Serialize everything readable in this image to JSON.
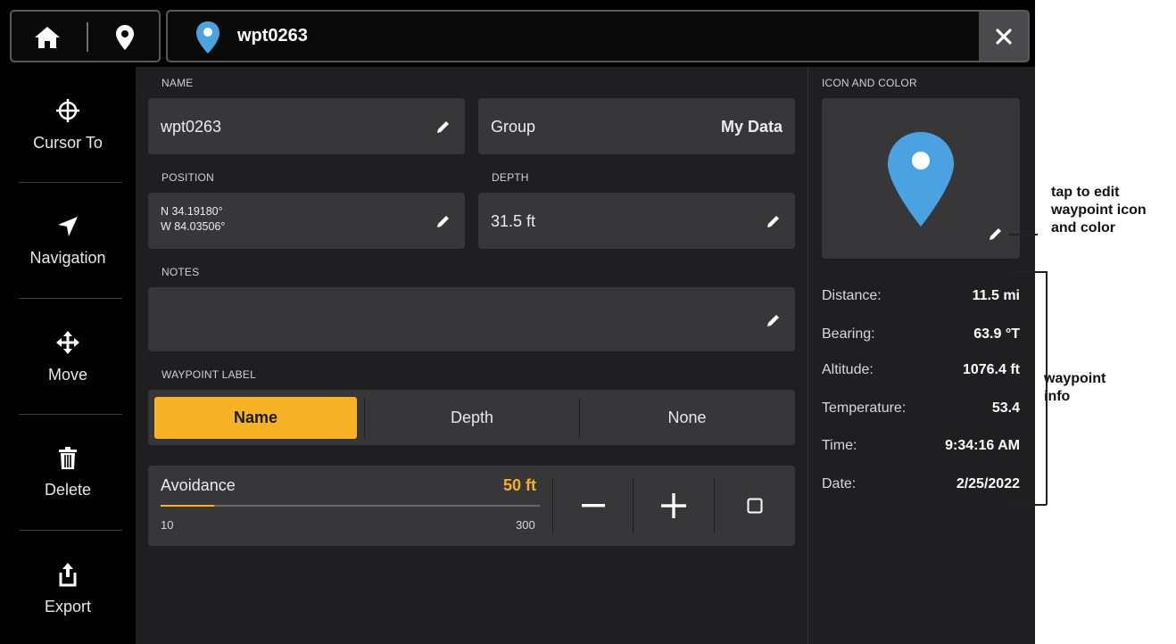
{
  "titlebar": {
    "title": "wpt0263"
  },
  "sidebar": {
    "items": [
      {
        "label": "Cursor To",
        "icon": "crosshair-icon"
      },
      {
        "label": "Navigation",
        "icon": "navigation-arrow-icon"
      },
      {
        "label": "Move",
        "icon": "move-icon"
      },
      {
        "label": "Delete",
        "icon": "trash-icon"
      },
      {
        "label": "Export",
        "icon": "export-icon"
      }
    ]
  },
  "form": {
    "name_label": "NAME",
    "name_value": "wpt0263",
    "group_label": "Group",
    "group_value": "My Data",
    "position_label": "POSITION",
    "position_lat": "N 34.19180°",
    "position_lon": "W 84.03506°",
    "depth_label": "DEPTH",
    "depth_value": "31.5 ft",
    "notes_label": "NOTES",
    "notes_value": "",
    "waypoint_label_title": "WAYPOINT LABEL",
    "label_options": [
      "Name",
      "Depth",
      "None"
    ],
    "label_selected": "Name",
    "avoidance_label": "Avoidance",
    "avoidance_value": "50 ft",
    "avoidance_min": "10",
    "avoidance_max": "300",
    "avoidance_fill": 0.14
  },
  "icon_color": {
    "label": "ICON AND COLOR",
    "pin_color": "#4aa3e0"
  },
  "info": {
    "rows": [
      {
        "k": "Distance:",
        "v": "11.5 mi"
      },
      {
        "k": "Bearing:",
        "v": "63.9 °T"
      },
      {
        "k": "Altitude:",
        "v": "1076.4 ft"
      },
      {
        "k": "Temperature:",
        "v": "53.4"
      },
      {
        "k": "Time:",
        "v": "9:34:16 AM"
      },
      {
        "k": "Date:",
        "v": "2/25/2022"
      }
    ]
  },
  "annotations": {
    "icon_edit_1": "tap to edit",
    "icon_edit_2": "waypoint icon",
    "icon_edit_3": "and color",
    "info_1": "waypoint",
    "info_2": "info"
  },
  "colors": {
    "accent": "#f8b226",
    "panel": "#1f1f21",
    "card": "#37373a"
  }
}
